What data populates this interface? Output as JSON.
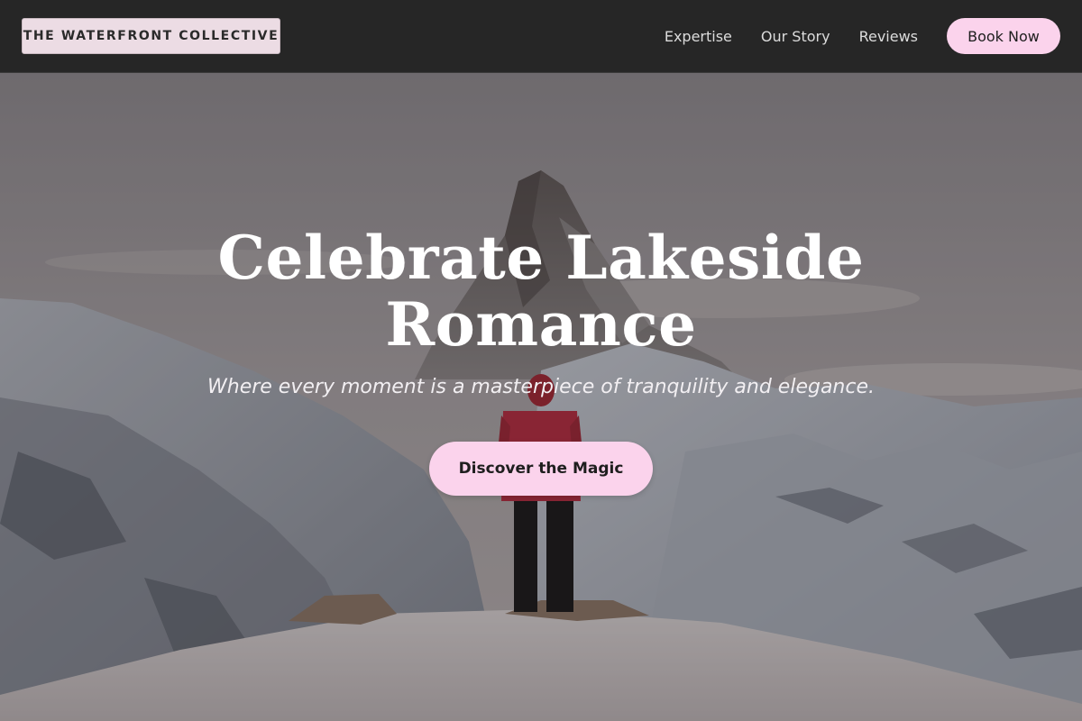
{
  "header": {
    "brand": "THE WATERFRONT COLLECTIVE",
    "nav": [
      {
        "label": "Expertise"
      },
      {
        "label": "Our Story"
      },
      {
        "label": "Reviews"
      }
    ],
    "book_label": "Book Now"
  },
  "hero": {
    "title_line1": "Celebrate Lakeside",
    "title_line2": "Romance",
    "subtitle": "Where every moment is a masterpiece of tranquility and elegance.",
    "cta_label": "Discover the Magic",
    "background_image": "snowy mountain peak with a hiker in a red jacket"
  },
  "colors": {
    "accent": "#fbd3ec",
    "header_bg": "#262626",
    "brand_bg": "#ecdce4"
  }
}
